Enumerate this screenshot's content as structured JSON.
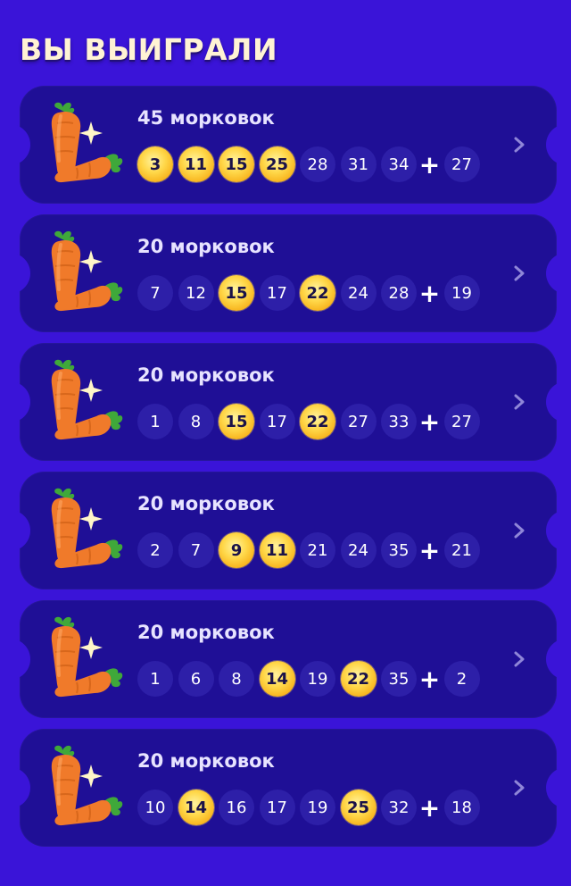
{
  "title": "ВЫ ВЫИГРАЛИ",
  "colors": {
    "background": "#3a14d8",
    "ticket": "#1f0f96",
    "ball": "#2d1fa8",
    "hit_ball": "#ffd84a"
  },
  "icons": {
    "prize": "carrot-icon",
    "sparkle": "sparkle-icon",
    "chevron": "chevron-right-icon"
  },
  "tickets": [
    {
      "prize": "45 морковок",
      "numbers": [
        {
          "n": "3",
          "hit": true
        },
        {
          "n": "11",
          "hit": true
        },
        {
          "n": "15",
          "hit": true
        },
        {
          "n": "25",
          "hit": true
        },
        {
          "n": "28",
          "hit": false
        },
        {
          "n": "31",
          "hit": false
        },
        {
          "n": "34",
          "hit": false
        }
      ],
      "bonus": "27"
    },
    {
      "prize": "20 морковок",
      "numbers": [
        {
          "n": "7",
          "hit": false
        },
        {
          "n": "12",
          "hit": false
        },
        {
          "n": "15",
          "hit": true
        },
        {
          "n": "17",
          "hit": false
        },
        {
          "n": "22",
          "hit": true
        },
        {
          "n": "24",
          "hit": false
        },
        {
          "n": "28",
          "hit": false
        }
      ],
      "bonus": "19"
    },
    {
      "prize": "20 морковок",
      "numbers": [
        {
          "n": "1",
          "hit": false
        },
        {
          "n": "8",
          "hit": false
        },
        {
          "n": "15",
          "hit": true
        },
        {
          "n": "17",
          "hit": false
        },
        {
          "n": "22",
          "hit": true
        },
        {
          "n": "27",
          "hit": false
        },
        {
          "n": "33",
          "hit": false
        }
      ],
      "bonus": "27"
    },
    {
      "prize": "20 морковок",
      "numbers": [
        {
          "n": "2",
          "hit": false
        },
        {
          "n": "7",
          "hit": false
        },
        {
          "n": "9",
          "hit": true
        },
        {
          "n": "11",
          "hit": true
        },
        {
          "n": "21",
          "hit": false
        },
        {
          "n": "24",
          "hit": false
        },
        {
          "n": "35",
          "hit": false
        }
      ],
      "bonus": "21"
    },
    {
      "prize": "20 морковок",
      "numbers": [
        {
          "n": "1",
          "hit": false
        },
        {
          "n": "6",
          "hit": false
        },
        {
          "n": "8",
          "hit": false
        },
        {
          "n": "14",
          "hit": true
        },
        {
          "n": "19",
          "hit": false
        },
        {
          "n": "22",
          "hit": true
        },
        {
          "n": "35",
          "hit": false
        }
      ],
      "bonus": "2"
    },
    {
      "prize": "20 морковок",
      "numbers": [
        {
          "n": "10",
          "hit": false
        },
        {
          "n": "14",
          "hit": true
        },
        {
          "n": "16",
          "hit": false
        },
        {
          "n": "17",
          "hit": false
        },
        {
          "n": "19",
          "hit": false
        },
        {
          "n": "25",
          "hit": true
        },
        {
          "n": "32",
          "hit": false
        }
      ],
      "bonus": "18"
    }
  ]
}
